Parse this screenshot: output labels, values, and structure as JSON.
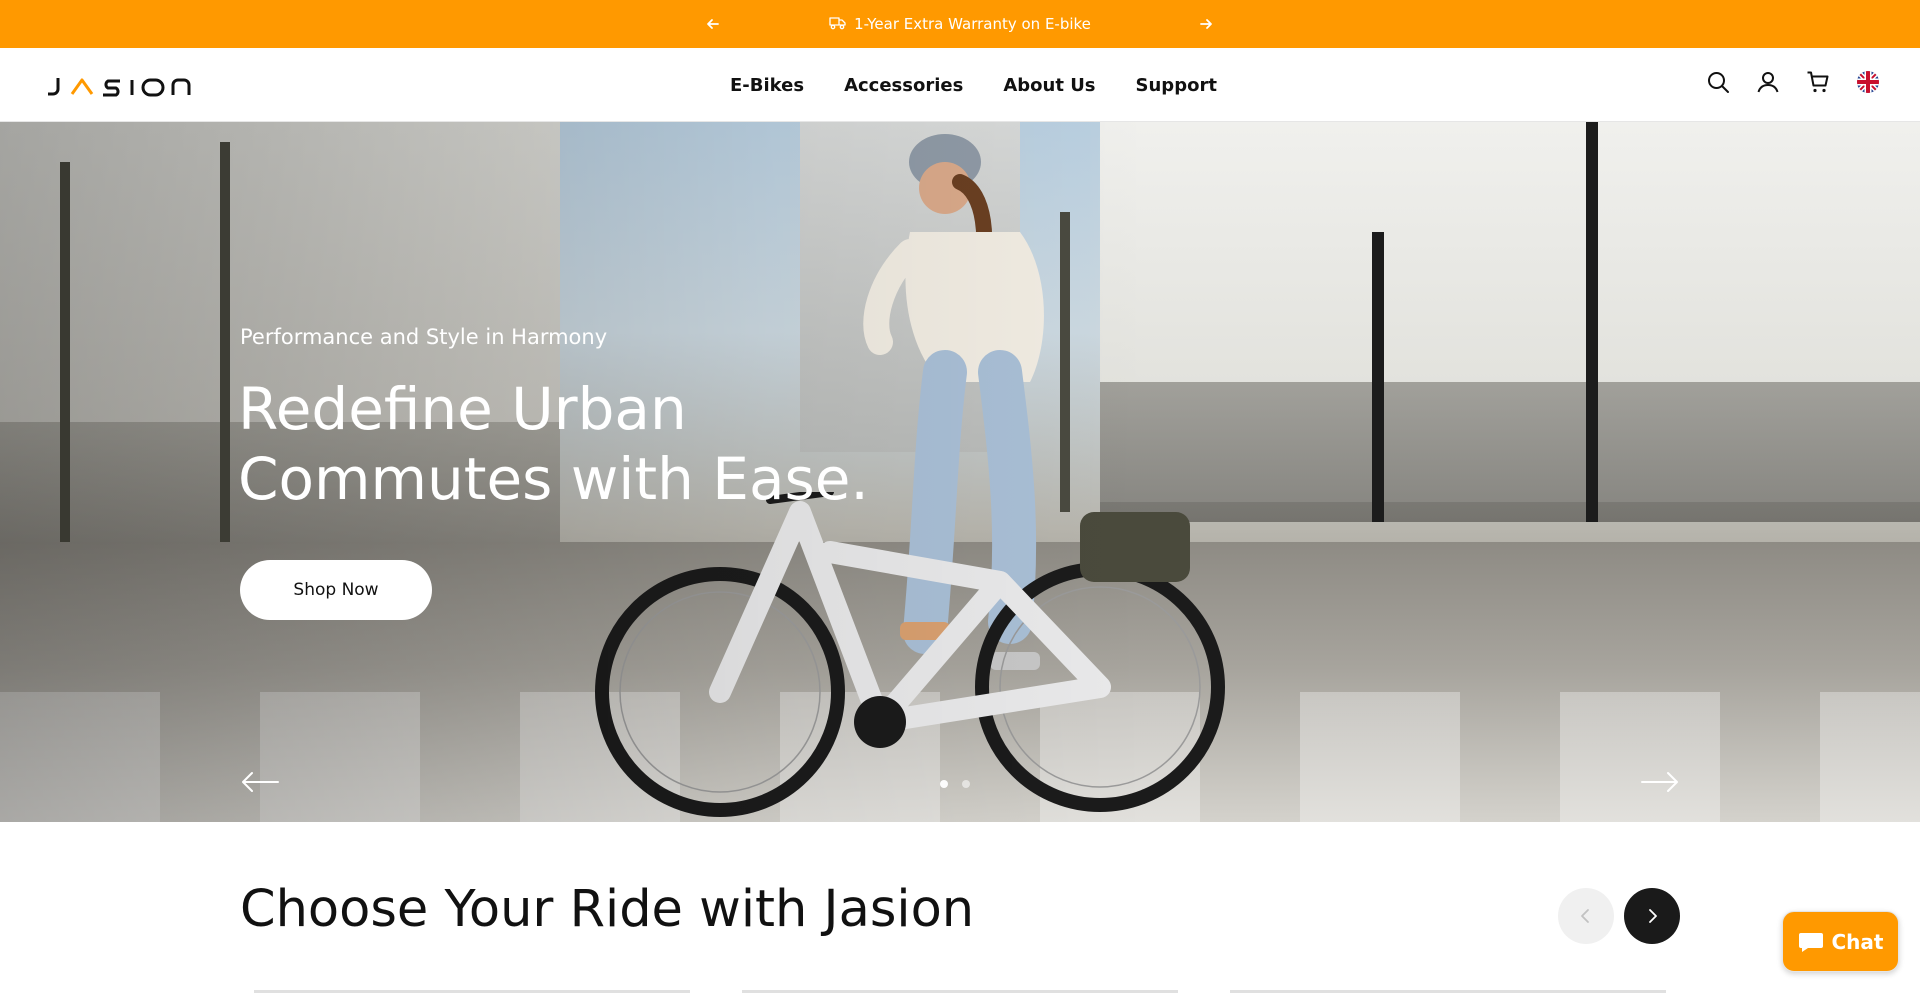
{
  "announcement": {
    "message": "1-Year Extra Warranty on E-bike",
    "icon": "truck-icon"
  },
  "header": {
    "logo_text": "JASION",
    "nav": [
      {
        "label": "E-Bikes"
      },
      {
        "label": "Accessories"
      },
      {
        "label": "About Us"
      },
      {
        "label": "Support"
      }
    ],
    "icons": [
      "search-icon",
      "account-icon",
      "cart-icon",
      "uk-flag-icon"
    ]
  },
  "hero": {
    "subtitle": "Performance and Style in Harmony",
    "headline_line1": "Redefine Urban",
    "headline_line2": "Commutes with Ease.",
    "cta_label": "Shop Now",
    "slide_count": 2,
    "active_slide": 1
  },
  "section": {
    "title": "Choose Your Ride with Jasion"
  },
  "chat": {
    "label": "Chat"
  },
  "colors": {
    "accent": "#ff9900",
    "dark": "#1a1a1a",
    "white": "#ffffff"
  }
}
